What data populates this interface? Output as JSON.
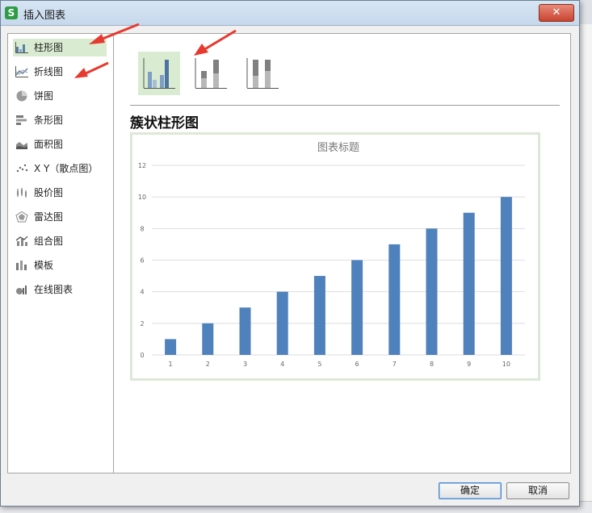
{
  "dialog": {
    "title": "插入图表",
    "app_icon": "S",
    "close_label": "✕"
  },
  "sidebar": {
    "items": [
      {
        "label": "柱形图",
        "icon": "column-chart-icon",
        "selected": true
      },
      {
        "label": "折线图",
        "icon": "line-chart-icon",
        "selected": false
      },
      {
        "label": "饼图",
        "icon": "pie-chart-icon",
        "selected": false
      },
      {
        "label": "条形图",
        "icon": "bar-chart-icon",
        "selected": false
      },
      {
        "label": "面积图",
        "icon": "area-chart-icon",
        "selected": false
      },
      {
        "label": "X Y（散点图）",
        "icon": "scatter-chart-icon",
        "selected": false
      },
      {
        "label": "股价图",
        "icon": "stock-chart-icon",
        "selected": false
      },
      {
        "label": "雷达图",
        "icon": "radar-chart-icon",
        "selected": false
      },
      {
        "label": "组合图",
        "icon": "combo-chart-icon",
        "selected": false
      },
      {
        "label": "模板",
        "icon": "template-icon",
        "selected": false
      },
      {
        "label": "在线图表",
        "icon": "online-chart-icon",
        "selected": false
      }
    ]
  },
  "subtypes": [
    {
      "name": "clustered-column",
      "selected": true
    },
    {
      "name": "stacked-column",
      "selected": false
    },
    {
      "name": "percent-stacked-column",
      "selected": false
    }
  ],
  "subtype_title": "簇状柱形图",
  "chart_data": {
    "type": "bar",
    "title": "图表标题",
    "categories": [
      "1",
      "2",
      "3",
      "4",
      "5",
      "6",
      "7",
      "8",
      "9",
      "10"
    ],
    "values": [
      1,
      2,
      3,
      4,
      5,
      6,
      7,
      8,
      9,
      10
    ],
    "yticks": [
      "0",
      "2",
      "4",
      "6",
      "8",
      "10",
      "12"
    ],
    "ylim": [
      0,
      12
    ],
    "grid": true,
    "bar_color": "#4f81bd"
  },
  "footer": {
    "ok_label": "确定",
    "cancel_label": "取消"
  },
  "colors": {
    "selected_bg": "#d9ecd1",
    "annotation_arrow": "#e63a2f"
  }
}
